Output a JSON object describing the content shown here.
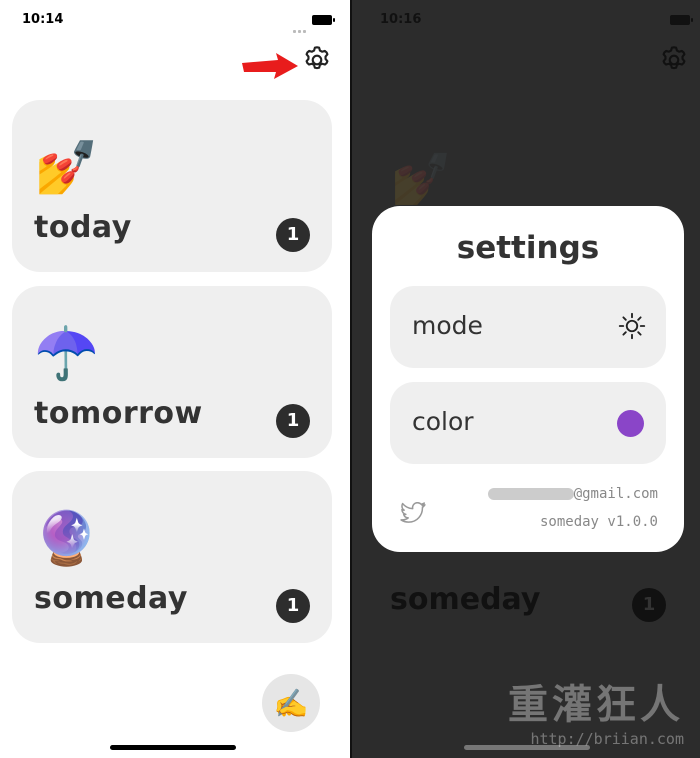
{
  "left_screen": {
    "status_time": "10:14",
    "cards": [
      {
        "emoji": "💅",
        "title": "today",
        "badge": "1"
      },
      {
        "emoji": "☂️",
        "title": "tomorrow",
        "badge": "1"
      },
      {
        "emoji": "🔮",
        "title": "someday",
        "badge": "1"
      }
    ],
    "fab_emoji": "✍️",
    "icons": {
      "settings": "gear-icon",
      "arrow": "red-arrow-icon"
    }
  },
  "right_screen": {
    "status_time": "10:16",
    "background_card_title": "someday",
    "background_card_badge": "1",
    "settings": {
      "title": "settings",
      "mode_label": "mode",
      "mode_icon": "sun-icon",
      "color_label": "color",
      "color_value": "#8a45c8",
      "email_visible": "@gmail.com",
      "version": "someday v1.0.0",
      "social_icon": "twitter-icon"
    }
  },
  "watermark": {
    "text": "重灌狂人",
    "url": "http://briian.com"
  },
  "colors": {
    "card_bg": "#efefef",
    "badge_bg": "#2d2d2d",
    "overlay_bg": "#2c2c2c",
    "accent": "#8a45c8"
  }
}
